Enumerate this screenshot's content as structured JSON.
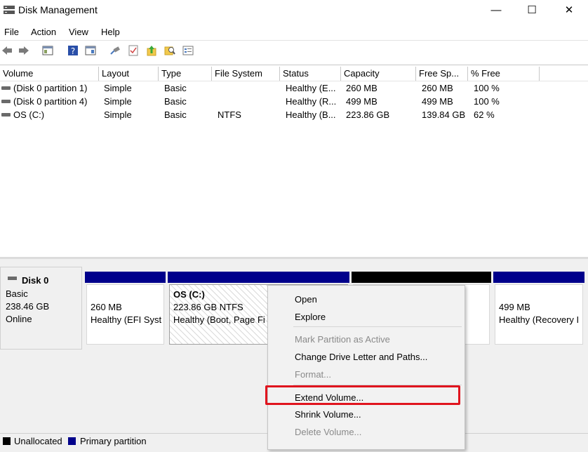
{
  "window": {
    "title": "Disk Management",
    "controls": {
      "minimize": "—",
      "maximize": "☐",
      "close": "✕"
    }
  },
  "menubar": {
    "items": [
      "File",
      "Action",
      "View",
      "Help"
    ]
  },
  "toolbar": {
    "icons": [
      "back-icon",
      "forward-icon",
      "console-tree-icon",
      "help-icon",
      "properties-icon",
      "connect-icon",
      "check-icon",
      "up-arrow-icon",
      "search-icon",
      "list-icon"
    ]
  },
  "volume_list": {
    "columns": [
      "Volume",
      "Layout",
      "Type",
      "File System",
      "Status",
      "Capacity",
      "Free Sp...",
      "% Free"
    ],
    "rows": [
      {
        "volume": "(Disk 0 partition 1)",
        "layout": "Simple",
        "type": "Basic",
        "file_system": "",
        "status": "Healthy (E...",
        "capacity": "260 MB",
        "free_space": "260 MB",
        "percent_free": "100 %"
      },
      {
        "volume": "(Disk 0 partition 4)",
        "layout": "Simple",
        "type": "Basic",
        "file_system": "",
        "status": "Healthy (R...",
        "capacity": "499 MB",
        "free_space": "499 MB",
        "percent_free": "100 %"
      },
      {
        "volume": "OS (C:)",
        "layout": "Simple",
        "type": "Basic",
        "file_system": "NTFS",
        "status": "Healthy (B...",
        "capacity": "223.86 GB",
        "free_space": "139.84 GB",
        "percent_free": "62 %"
      }
    ]
  },
  "disk": {
    "name": "Disk 0",
    "type": "Basic",
    "size": "238.46 GB",
    "state": "Online",
    "partitions": [
      {
        "line1": "260 MB",
        "line2": "Healthy (EFI Syst"
      },
      {
        "title": "OS  (C:)",
        "line1": "223.86 GB NTFS",
        "line2": "Healthy (Boot, Page Fi"
      },
      {
        "line1": "",
        "line2": ""
      },
      {
        "line1": "499 MB",
        "line2": "Healthy (Recovery I"
      }
    ]
  },
  "context_menu": {
    "items": [
      {
        "label": "Open",
        "enabled": true
      },
      {
        "label": "Explore",
        "enabled": true
      },
      {
        "label": "Mark Partition as Active",
        "enabled": false
      },
      {
        "label": "Change Drive Letter and Paths...",
        "enabled": true
      },
      {
        "label": "Format...",
        "enabled": false
      },
      {
        "label": "Extend Volume...",
        "enabled": true
      },
      {
        "label": "Shrink Volume...",
        "enabled": true
      },
      {
        "label": "Delete Volume...",
        "enabled": false
      }
    ]
  },
  "legend": {
    "items": [
      {
        "label": "Unallocated",
        "color": "#000000"
      },
      {
        "label": "Primary partition",
        "color": "#00008b"
      }
    ]
  },
  "colors": {
    "primary_partition": "#00008b",
    "unallocated": "#000000",
    "highlight": "#e0141e"
  }
}
